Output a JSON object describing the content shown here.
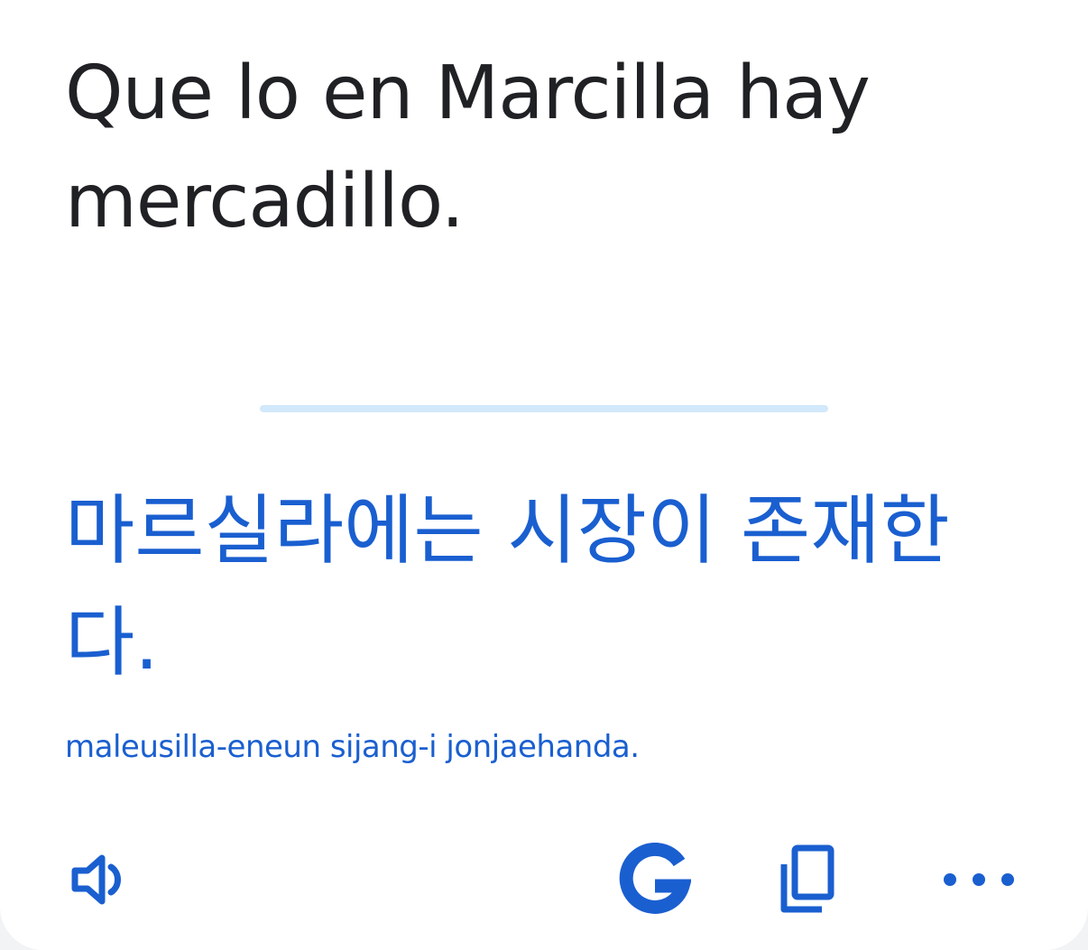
{
  "source": {
    "text": "Que lo en Marcilla hay mercadillo."
  },
  "translation": {
    "text": "마르실라에는 시장이 존재한다.",
    "romanization": "maleusilla-eneun sijang-i jonjaehanda."
  },
  "actions": {
    "speak_icon": "speaker-icon",
    "google_icon": "google-g-icon",
    "copy_icon": "copy-icon",
    "more_icon": "more-horizontal-icon"
  },
  "colors": {
    "accent": "#1a5fd0",
    "source_text": "#202124",
    "divider": "#d2e9fb",
    "background": "#ffffff"
  }
}
